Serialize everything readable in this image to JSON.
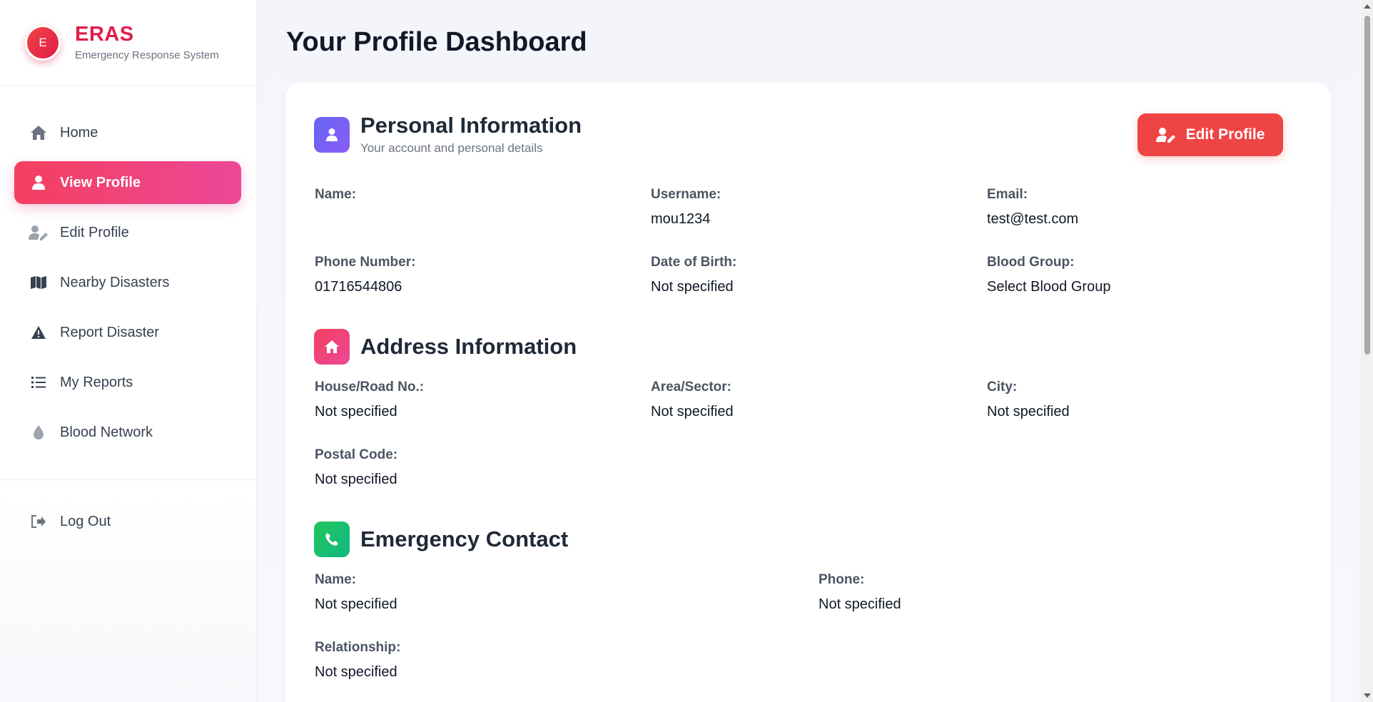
{
  "brand": {
    "logo_letter": "E",
    "name": "ERAS",
    "subtitle": "Emergency Response System"
  },
  "sidebar": {
    "items": [
      {
        "label": "Home",
        "icon": "home-icon"
      },
      {
        "label": "View Profile",
        "icon": "user-icon",
        "active": true
      },
      {
        "label": "Edit Profile",
        "icon": "user-edit-icon"
      },
      {
        "label": "Nearby Disasters",
        "icon": "map-icon"
      },
      {
        "label": "Report Disaster",
        "icon": "warning-icon"
      },
      {
        "label": "My Reports",
        "icon": "list-icon"
      },
      {
        "label": "Blood Network",
        "icon": "drop-icon"
      }
    ],
    "logout_label": "Log Out"
  },
  "main": {
    "page_title": "Your Profile Dashboard",
    "edit_button_label": "Edit Profile",
    "personal": {
      "title": "Personal Information",
      "subtitle": "Your account and personal details",
      "name_label": "Name:",
      "name_value": "",
      "username_label": "Username:",
      "username_value": "mou1234",
      "email_label": "Email:",
      "email_value": "test@test.com",
      "phone_label": "Phone Number:",
      "phone_value": "01716544806",
      "dob_label": "Date of Birth:",
      "dob_value": "Not specified",
      "blood_label": "Blood Group:",
      "blood_value": "Select Blood Group"
    },
    "address": {
      "title": "Address Information",
      "house_label": "House/Road No.:",
      "house_value": "Not specified",
      "area_label": "Area/Sector:",
      "area_value": "Not specified",
      "city_label": "City:",
      "city_value": "Not specified",
      "postal_label": "Postal Code:",
      "postal_value": "Not specified"
    },
    "emergency": {
      "title": "Emergency Contact",
      "name_label": "Name:",
      "name_value": "Not specified",
      "phone_label": "Phone:",
      "phone_value": "Not specified",
      "relationship_label": "Relationship:",
      "relationship_value": "Not specified"
    }
  },
  "colors": {
    "accent": "#ef4444",
    "brand": "#e11d48",
    "active_nav": "#ec4899"
  }
}
